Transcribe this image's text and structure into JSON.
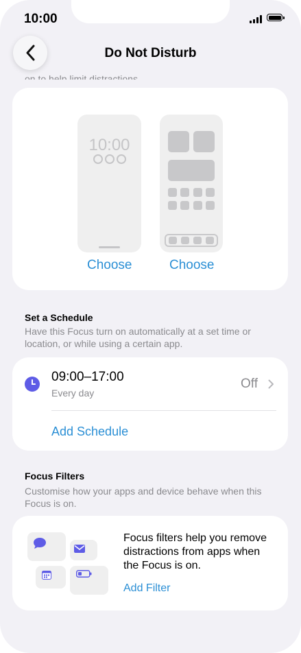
{
  "status_bar": {
    "time": "10:00"
  },
  "nav": {
    "title": "Do Not Disturb",
    "back_icon": "chevron-left-icon"
  },
  "intro": {
    "clipped_text": "on to help limit distractions."
  },
  "screens": {
    "lock_preview_time": "10:00",
    "lock_choose_label": "Choose",
    "home_choose_label": "Choose"
  },
  "schedule": {
    "title": "Set a Schedule",
    "description": "Have this Focus turn on automatically at a set time or location, or while using a certain app.",
    "item": {
      "time_range": "09:00–17:00",
      "repeat": "Every day",
      "status": "Off"
    },
    "add_label": "Add Schedule"
  },
  "filters": {
    "title": "Focus Filters",
    "description": "Customise how your apps and device behave when this Focus is on.",
    "info_text": "Focus filters help you remove distractions from apps when the Focus is on.",
    "add_label": "Add Filter",
    "icons": [
      "message-icon",
      "mail-icon",
      "calendar-icon",
      "battery-icon"
    ]
  },
  "colors": {
    "accent": "#2b8fd5",
    "focus_purple": "#5e5ce6",
    "background": "#f2f1f6"
  }
}
